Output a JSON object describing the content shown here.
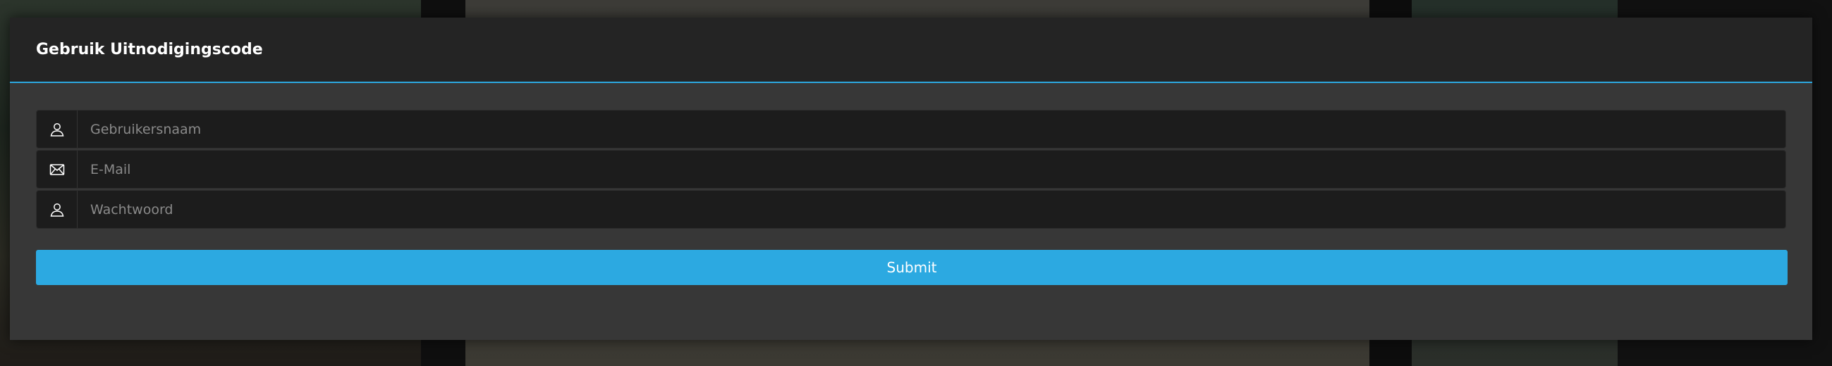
{
  "modal": {
    "title": "Gebruik Uitnodigingscode"
  },
  "form": {
    "fields": [
      {
        "icon": "user-icon",
        "placeholder": "Gebruikersnaam",
        "value": ""
      },
      {
        "icon": "mail-icon",
        "placeholder": "E-Mail",
        "value": ""
      },
      {
        "icon": "user-icon",
        "placeholder": "Wachtwoord",
        "value": ""
      }
    ],
    "submit_label": "Submit"
  },
  "colors": {
    "accent": "#2ca9e1",
    "modal_header_bg": "#242424",
    "modal_body_bg": "#373737",
    "input_bg": "#1c1c1c"
  }
}
